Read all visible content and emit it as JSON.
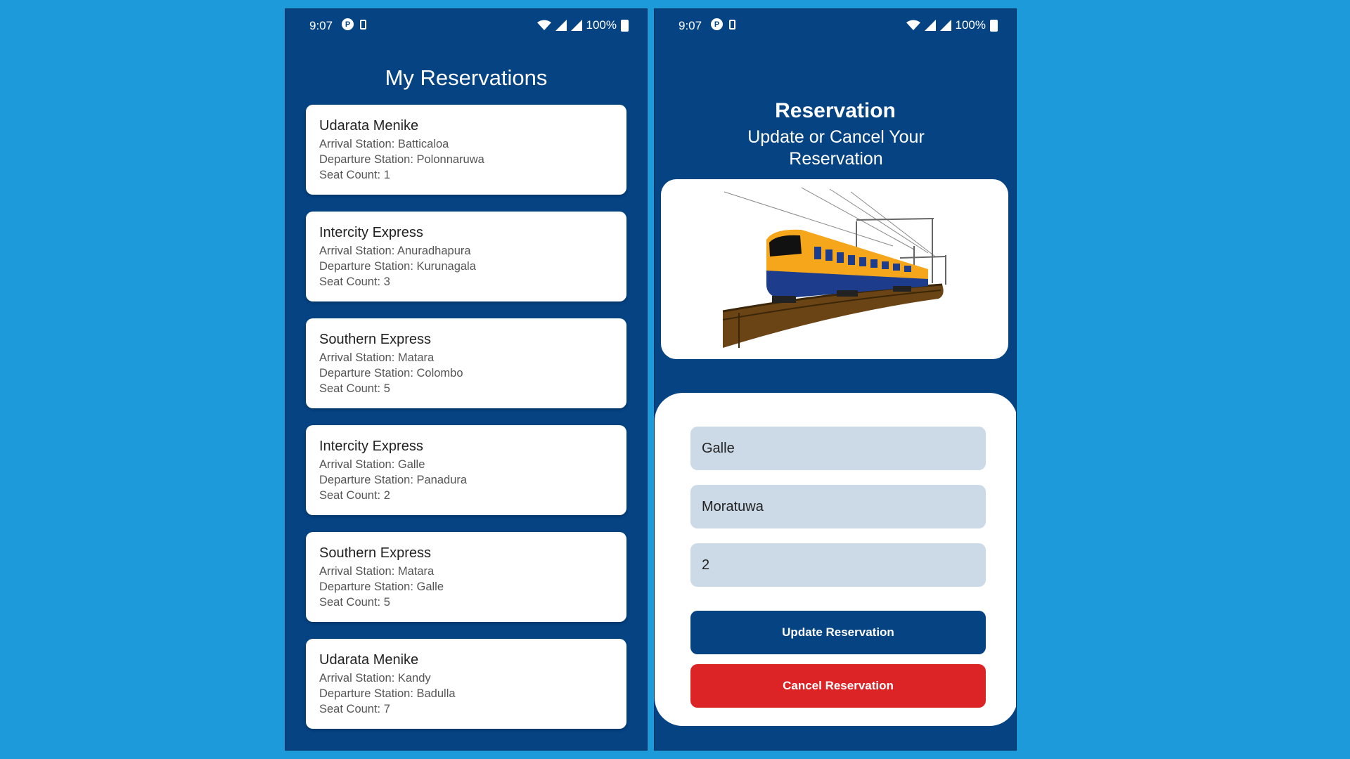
{
  "status_bar": {
    "time": "9:07",
    "battery": "100%"
  },
  "reservations_screen": {
    "title": "My Reservations",
    "reservations": [
      {
        "name": "Udarata Menike",
        "arrival": "Arrival Station: Batticaloa",
        "departure": "Departure Station: Polonnaruwa",
        "seats": "Seat Count: 1"
      },
      {
        "name": "Intercity Express",
        "arrival": "Arrival Station: Anuradhapura",
        "departure": "Departure Station: Kurunagala",
        "seats": "Seat Count: 3"
      },
      {
        "name": "Southern Express",
        "arrival": "Arrival Station: Matara",
        "departure": "Departure Station: Colombo",
        "seats": "Seat Count: 5"
      },
      {
        "name": "Intercity Express",
        "arrival": "Arrival Station: Galle",
        "departure": "Departure Station: Panadura",
        "seats": "Seat Count: 2"
      },
      {
        "name": "Southern Express",
        "arrival": "Arrival Station: Matara",
        "departure": "Departure Station: Galle",
        "seats": "Seat Count: 5"
      },
      {
        "name": "Udarata Menike",
        "arrival": "Arrival Station: Kandy",
        "departure": "Departure Station: Badulla",
        "seats": "Seat Count: 7"
      }
    ]
  },
  "reservation_form": {
    "title": "Reservation",
    "subtitle": "Update or Cancel Your Reservation",
    "image_icon": "train-illustration",
    "arrival_value": "Galle",
    "departure_value": "Moratuwa",
    "seat_count_value": "2",
    "update_label": "Update Reservation",
    "cancel_label": "Cancel Reservation"
  },
  "colors": {
    "background": "#1c9ad9",
    "app_primary": "#054383",
    "input_bg": "#ccd9e6",
    "cancel_red": "#dc2326"
  }
}
